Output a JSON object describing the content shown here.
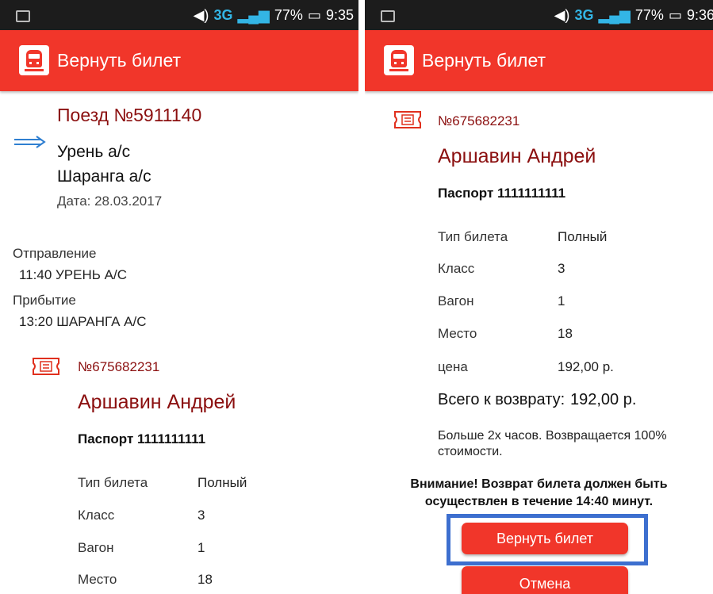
{
  "status": {
    "battery": "77%",
    "time_left": "9:35",
    "time_right": "9:36",
    "network": "3G"
  },
  "app": {
    "title": "Вернуть билет"
  },
  "train": {
    "title": "Поезд №5911140",
    "from": "Урень а/с",
    "to": "Шаранга а/с",
    "date": "Дата: 28.03.2017"
  },
  "schedule": {
    "departure_label": "Отправление",
    "departure_value": "11:40  УРЕНЬ А/С",
    "arrival_label": "Прибытие",
    "arrival_value": "13:20  ШАРАНГА А/С"
  },
  "ticket": {
    "number": "№675682231",
    "passenger": "Аршавин Андрей",
    "passport": "Паспорт 1111111111",
    "rows": [
      {
        "label": "Тип билета",
        "value": "Полный"
      },
      {
        "label": "Класс",
        "value": "3"
      },
      {
        "label": "Вагон",
        "value": "1"
      },
      {
        "label": "Место",
        "value": "18"
      },
      {
        "label": "цена",
        "value": "192,00 р."
      }
    ]
  },
  "refund": {
    "total_label": "Всего к возврату:",
    "total_value": "192,00 р.",
    "note_line1": "Больше 2х часов. Возвращается 100%",
    "note_line2": "стоимости.",
    "warning_line1": "Внимание! Возврат билета должен быть",
    "warning_line2": "осуществлен в течение 14:40 минут."
  },
  "buttons": {
    "return_label": "Вернуть билет",
    "cancel_label": "Отмена"
  }
}
